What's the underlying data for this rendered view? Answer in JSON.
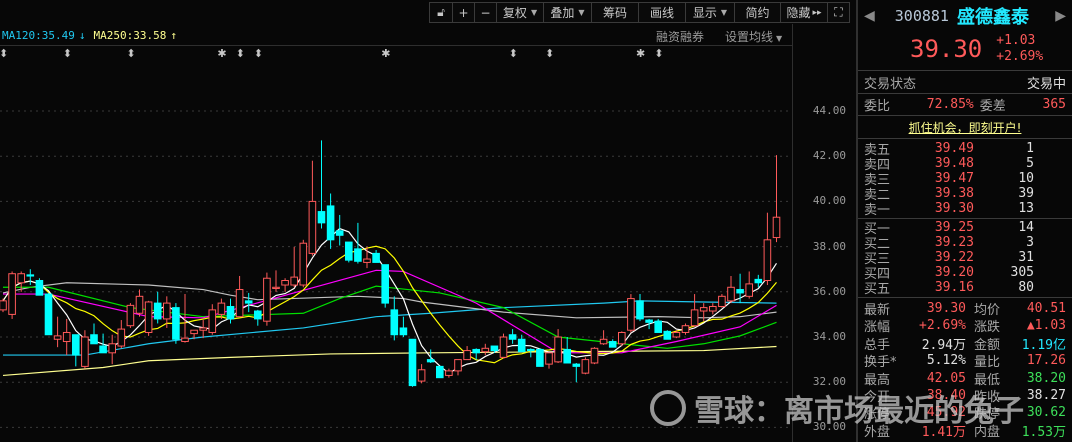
{
  "toolbar": {
    "items": [
      {
        "label": "",
        "icon": "unlock-icon"
      },
      {
        "label": "+",
        "icon": "plus-icon"
      },
      {
        "label": "−",
        "icon": "minus-icon"
      },
      {
        "label": "复权",
        "dropdown": true
      },
      {
        "label": "叠加",
        "dropdown": true
      },
      {
        "label": "筹码"
      },
      {
        "label": "画线"
      },
      {
        "label": "显示",
        "dropdown": true
      },
      {
        "label": "简约"
      },
      {
        "label": "隐藏",
        "suffix": "▸▸"
      },
      {
        "label": "",
        "icon": "fullscreen-icon"
      }
    ]
  },
  "ma_legend": {
    "ma120": "MA120:35.49",
    "ma120_arrow": "↓",
    "ma250": "MA250:33.58",
    "ma250_arrow": "↑"
  },
  "sub_links": {
    "margin": "融资融券",
    "set_ma": "设置均线"
  },
  "markers": [
    {
      "idx": 0,
      "glyph": "⬍"
    },
    {
      "idx": 7,
      "glyph": "⬍"
    },
    {
      "idx": 14,
      "glyph": "⬍"
    },
    {
      "idx": 24,
      "glyph": "✱"
    },
    {
      "idx": 26,
      "glyph": "⬍"
    },
    {
      "idx": 28,
      "glyph": "⬍"
    },
    {
      "idx": 42,
      "glyph": "✱"
    },
    {
      "idx": 56,
      "glyph": "⬍"
    },
    {
      "idx": 60,
      "glyph": "⬍"
    },
    {
      "idx": 70,
      "glyph": "✱"
    },
    {
      "idx": 72,
      "glyph": "⬍"
    }
  ],
  "colors": {
    "up": "#ff5a5a",
    "down": "#00ffff",
    "ma5": "#ffffff",
    "ma10": "#ffff00",
    "ma20": "#ff00ff",
    "ma30": "#00e000",
    "ma60": "#c0c0c0",
    "ma120": "#20c8f0",
    "ma250": "#ffff90"
  },
  "chart_data": {
    "type": "candlestick",
    "ylim": [
      29.8,
      44.6
    ],
    "yticks": [
      "44.00",
      "42.00",
      "40.00",
      "38.00",
      "36.00",
      "34.00",
      "32.00",
      "30.00"
    ],
    "candles": [
      [
        35.2,
        35.7,
        35.1,
        35.6
      ],
      [
        35.0,
        36.9,
        34.8,
        36.8
      ],
      [
        36.4,
        36.9,
        36.0,
        36.8
      ],
      [
        36.75,
        37.0,
        36.3,
        36.7
      ],
      [
        36.5,
        36.6,
        35.85,
        35.85
      ],
      [
        35.9,
        35.95,
        34.1,
        34.1
      ],
      [
        33.9,
        34.9,
        33.55,
        34.05
      ],
      [
        33.8,
        34.8,
        33.2,
        34.2
      ],
      [
        34.1,
        34.1,
        32.7,
        33.2
      ],
      [
        32.7,
        34.3,
        32.6,
        34.0
      ],
      [
        34.1,
        34.6,
        33.7,
        33.7
      ],
      [
        33.6,
        34.15,
        33.3,
        33.3
      ],
      [
        33.3,
        34.1,
        32.8,
        33.7
      ],
      [
        33.6,
        34.75,
        33.5,
        34.35
      ],
      [
        34.5,
        35.5,
        34.4,
        35.4
      ],
      [
        35.05,
        36.1,
        34.9,
        35.8
      ],
      [
        34.2,
        35.6,
        34.05,
        35.55
      ],
      [
        35.5,
        36.0,
        34.6,
        34.8
      ],
      [
        34.8,
        35.8,
        34.4,
        35.5
      ],
      [
        35.3,
        35.5,
        33.7,
        33.9
      ],
      [
        33.8,
        35.9,
        33.75,
        33.95
      ],
      [
        34.15,
        34.3,
        33.9,
        34.3
      ],
      [
        34.3,
        34.75,
        33.95,
        34.4
      ],
      [
        34.2,
        35.45,
        34.1,
        35.2
      ],
      [
        35.0,
        35.7,
        34.8,
        35.5
      ],
      [
        35.35,
        35.7,
        34.6,
        34.8
      ],
      [
        34.9,
        36.7,
        34.9,
        36.1
      ],
      [
        35.6,
        35.95,
        35.1,
        35.5
      ],
      [
        35.15,
        35.2,
        34.5,
        34.8
      ],
      [
        34.7,
        36.85,
        34.5,
        36.6
      ],
      [
        36.15,
        36.95,
        36.0,
        36.2
      ],
      [
        36.3,
        36.6,
        36.0,
        36.5
      ],
      [
        36.3,
        37.99,
        36.2,
        36.65
      ],
      [
        36.3,
        38.3,
        36.2,
        38.15
      ],
      [
        37.7,
        41.8,
        37.6,
        40.0
      ],
      [
        39.55,
        42.7,
        38.8,
        39.05
      ],
      [
        39.8,
        40.35,
        37.9,
        38.3
      ],
      [
        38.7,
        39.4,
        38.05,
        38.5
      ],
      [
        38.2,
        38.2,
        37.3,
        37.4
      ],
      [
        37.9,
        39.05,
        37.25,
        37.35
      ],
      [
        37.3,
        38.0,
        37.05,
        37.45
      ],
      [
        37.7,
        37.85,
        37.3,
        37.3
      ],
      [
        37.2,
        37.2,
        35.3,
        35.5
      ],
      [
        35.2,
        35.8,
        33.85,
        34.1
      ],
      [
        34.4,
        34.9,
        34.0,
        34.1
      ],
      [
        33.9,
        33.9,
        31.8,
        31.85
      ],
      [
        32.05,
        32.8,
        31.95,
        32.55
      ],
      [
        33.0,
        33.45,
        32.85,
        32.9
      ],
      [
        32.7,
        32.7,
        32.2,
        32.2
      ],
      [
        32.3,
        32.6,
        32.2,
        32.5
      ],
      [
        32.5,
        33.0,
        32.3,
        33.0
      ],
      [
        33.0,
        33.6,
        33.0,
        33.4
      ],
      [
        33.45,
        33.5,
        33.0,
        33.3
      ],
      [
        33.35,
        33.7,
        33.2,
        33.5
      ],
      [
        33.6,
        33.6,
        33.3,
        33.4
      ],
      [
        33.1,
        34.15,
        33.05,
        34.0
      ],
      [
        34.1,
        34.35,
        33.7,
        33.9
      ],
      [
        33.9,
        34.1,
        33.35,
        33.35
      ],
      [
        33.45,
        33.5,
        33.1,
        33.4
      ],
      [
        33.45,
        33.5,
        32.7,
        32.7
      ],
      [
        32.8,
        33.3,
        32.6,
        33.3
      ],
      [
        32.9,
        34.35,
        32.85,
        34.0
      ],
      [
        33.45,
        34.0,
        32.85,
        32.85
      ],
      [
        32.8,
        32.85,
        32.0,
        32.7
      ],
      [
        32.4,
        33.1,
        32.35,
        33.0
      ],
      [
        32.85,
        33.55,
        32.8,
        33.5
      ],
      [
        33.7,
        34.3,
        33.65,
        33.9
      ],
      [
        33.8,
        33.9,
        33.55,
        33.55
      ],
      [
        33.7,
        34.25,
        33.6,
        34.2
      ],
      [
        34.3,
        35.9,
        34.2,
        35.7
      ],
      [
        35.6,
        35.9,
        34.7,
        34.8
      ],
      [
        34.75,
        34.8,
        34.35,
        34.65
      ],
      [
        34.7,
        34.8,
        34.2,
        34.2
      ],
      [
        34.25,
        34.3,
        33.9,
        33.9
      ],
      [
        34.0,
        34.3,
        33.95,
        34.2
      ],
      [
        34.2,
        34.6,
        34.1,
        34.5
      ],
      [
        34.5,
        35.9,
        34.45,
        35.2
      ],
      [
        35.15,
        35.5,
        34.7,
        35.3
      ],
      [
        35.15,
        35.5,
        35.0,
        35.35
      ],
      [
        35.35,
        35.9,
        35.3,
        35.8
      ],
      [
        35.6,
        36.7,
        35.5,
        36.2
      ],
      [
        36.1,
        36.8,
        35.5,
        35.95
      ],
      [
        35.8,
        36.9,
        35.7,
        36.35
      ],
      [
        36.55,
        36.75,
        36.2,
        36.4
      ],
      [
        36.5,
        39.5,
        36.3,
        38.3
      ],
      [
        38.4,
        42.05,
        38.2,
        39.3
      ]
    ],
    "ma_lines": {
      "ma20": [
        [
          0,
          35.9
        ],
        [
          5,
          35.9
        ],
        [
          16,
          34.9
        ],
        [
          22,
          34.85
        ],
        [
          41,
          36.95
        ],
        [
          44,
          36.9
        ],
        [
          52,
          35.5
        ],
        [
          61,
          33.3
        ],
        [
          68,
          33.3
        ],
        [
          74,
          33.8
        ],
        [
          81,
          34.45
        ],
        [
          85,
          35.4
        ]
      ],
      "ma30": [
        [
          0,
          36.2
        ],
        [
          5,
          36.2
        ],
        [
          14,
          35.3
        ],
        [
          22,
          34.9
        ],
        [
          33,
          35.05
        ],
        [
          37,
          35.7
        ],
        [
          41,
          36.25
        ],
        [
          48,
          35.95
        ],
        [
          55,
          35.3
        ],
        [
          61,
          34.0
        ],
        [
          68,
          33.7
        ],
        [
          73,
          33.5
        ],
        [
          77,
          33.7
        ],
        [
          81,
          34.05
        ],
        [
          85,
          34.65
        ]
      ],
      "ma60": [
        [
          0,
          35.95
        ],
        [
          3,
          36.2
        ],
        [
          7,
          36.4
        ],
        [
          16,
          36.3
        ],
        [
          22,
          36.1
        ],
        [
          25,
          35.85
        ],
        [
          28,
          35.65
        ],
        [
          39,
          35.8
        ],
        [
          44,
          35.7
        ],
        [
          46,
          35.55
        ],
        [
          55,
          35.1
        ],
        [
          63,
          34.85
        ],
        [
          72,
          34.9
        ],
        [
          77,
          34.85
        ],
        [
          81,
          34.9
        ],
        [
          85,
          35.1
        ]
      ],
      "ma120": [
        [
          0,
          33.2
        ],
        [
          9,
          33.2
        ],
        [
          16,
          33.7
        ],
        [
          22,
          34.0
        ],
        [
          33,
          34.4
        ],
        [
          41,
          34.9
        ],
        [
          47,
          35.05
        ],
        [
          55,
          35.3
        ],
        [
          66,
          35.5
        ],
        [
          70,
          35.6
        ],
        [
          77,
          35.55
        ],
        [
          85,
          35.5
        ]
      ],
      "ma250": [
        [
          0,
          32.3
        ],
        [
          11,
          32.65
        ],
        [
          16,
          32.95
        ],
        [
          25,
          33.1
        ],
        [
          36,
          33.25
        ],
        [
          47,
          33.3
        ],
        [
          77,
          33.4
        ],
        [
          85,
          33.58
        ]
      ]
    }
  },
  "quote": {
    "code": "300881",
    "name": "盛德鑫泰",
    "price": "39.30",
    "change": "+1.03",
    "change_pct": "+2.69%",
    "status_label": "交易状态",
    "status_value": "交易中",
    "weibi_label": "委比",
    "weibi_value": "72.85%",
    "weicha_label": "委差",
    "weicha_value": "365",
    "promo": "抓住机会，即刻开户!",
    "asks": [
      {
        "label": "卖五",
        "price": "39.49",
        "vol": "1"
      },
      {
        "label": "卖四",
        "price": "39.48",
        "vol": "5"
      },
      {
        "label": "卖三",
        "price": "39.47",
        "vol": "10"
      },
      {
        "label": "卖二",
        "price": "39.38",
        "vol": "39"
      },
      {
        "label": "卖一",
        "price": "39.30",
        "vol": "13"
      }
    ],
    "bids": [
      {
        "label": "买一",
        "price": "39.25",
        "vol": "14"
      },
      {
        "label": "买二",
        "price": "39.23",
        "vol": "3"
      },
      {
        "label": "买三",
        "price": "39.22",
        "vol": "31"
      },
      {
        "label": "买四",
        "price": "39.20",
        "vol": "305"
      },
      {
        "label": "买五",
        "price": "39.16",
        "vol": "80"
      }
    ],
    "stats": [
      {
        "l1": "最新",
        "v1": "39.30",
        "c1": "red",
        "l2": "均价",
        "v2": "40.51",
        "c2": "red"
      },
      {
        "l1": "涨幅",
        "v1": "+2.69%",
        "c1": "red",
        "l2": "涨跌",
        "v2": "▲1.03",
        "c2": "red"
      },
      {
        "l1": "总手",
        "v1": "2.94万",
        "c1": "white",
        "l2": "金额",
        "v2": "1.19亿",
        "c2": "cyan"
      },
      {
        "l1": "换手*",
        "v1": "5.12%",
        "c1": "white",
        "l2": "量比",
        "v2": "17.26",
        "c2": "red"
      },
      {
        "l1": "最高",
        "v1": "42.05",
        "c1": "red",
        "l2": "最低",
        "v2": "38.20",
        "c2": "green"
      },
      {
        "l1": "今开",
        "v1": "38.40",
        "c1": "red",
        "l2": "昨收",
        "v2": "38.27",
        "c2": "white"
      },
      {
        "l1": "涨停",
        "v1": "45.92",
        "c1": "red",
        "l2": "跌停",
        "v2": "30.62",
        "c2": "green"
      },
      {
        "l1": "外盘",
        "v1": "1.41万",
        "c1": "red",
        "l2": "内盘",
        "v2": "1.53万",
        "c2": "green"
      }
    ]
  },
  "watermark": "雪球：离市场最近的兔子"
}
